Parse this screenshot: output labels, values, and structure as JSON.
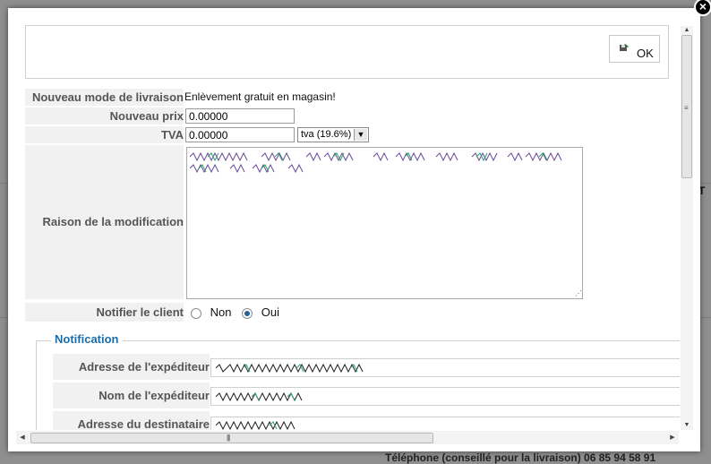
{
  "background": {
    "footer_text": "Téléphone (conseillé pour la livraison) 06 85 94 58 91",
    "side_text": "T"
  },
  "dialog": {
    "close_label": "×",
    "ok_label": "OK"
  },
  "form": {
    "mode_label": "Nouveau mode de livraison",
    "mode_value": "Enlèvement gratuit en magasin!",
    "price_label": "Nouveau prix",
    "price_value": "0.00000",
    "tva_label": "TVA",
    "tva_value": "0.00000",
    "tva_select": "tva (19.6%)",
    "reason_label": "Raison de la modification",
    "notify_label": "Notifier le client",
    "notify_no": "Non",
    "notify_yes": "Oui",
    "notify_selected": "Oui"
  },
  "notification": {
    "legend": "Notification",
    "sender_address_label": "Adresse de l'expéditeur",
    "sender_name_label": "Nom de l'expéditeur",
    "recipient_address_label": "Adresse du destinataire"
  },
  "colors": {
    "legend": "#1c6ca8",
    "label_bg": "#f1f1f1",
    "radio_selected": "#24609a"
  }
}
